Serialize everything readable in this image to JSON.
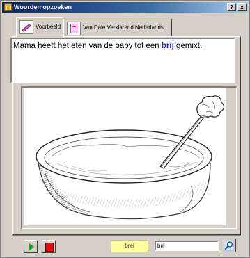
{
  "window": {
    "title": "Woorden opzoeken",
    "help_label": "?",
    "close_label": "x"
  },
  "tabs": [
    {
      "label": "Voorbeeld",
      "icon": "pencil-icon",
      "selected": true
    },
    {
      "label": "Van Dale Verklarend Nederlands",
      "icon": "notebook-icon",
      "selected": false
    }
  ],
  "sentence": {
    "before": "Mama heeft het eten van de baby tot een ",
    "keyword": "brij",
    "after": " gemixt."
  },
  "illustration": {
    "subject": "bowl-with-spoon-sketch"
  },
  "controls": {
    "play_icon": "play-icon",
    "stop_icon": "stop-icon",
    "word_chip": "brei",
    "search_value": "brij",
    "search_icon": "magnifier-icon"
  },
  "colors": {
    "titlebar_start": "#0a246a",
    "keyword": "#2020b0",
    "play": "#14a514",
    "stop": "#e01010",
    "chip": "#ffffa0"
  }
}
